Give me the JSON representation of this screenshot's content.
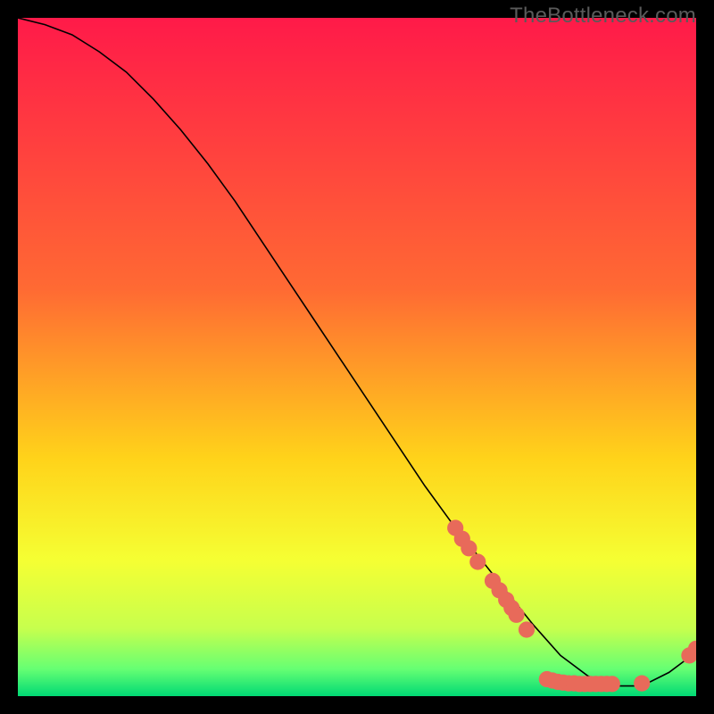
{
  "watermark": "TheBottleneck.com",
  "chart_data": {
    "type": "line",
    "title": "",
    "xlabel": "",
    "ylabel": "",
    "xlim": [
      0,
      100
    ],
    "ylim": [
      0,
      100
    ],
    "grid": false,
    "legend": false,
    "gradient_stops": [
      {
        "offset": 0.0,
        "color": "#ff1a49"
      },
      {
        "offset": 0.4,
        "color": "#ff6a33"
      },
      {
        "offset": 0.65,
        "color": "#ffd31a"
      },
      {
        "offset": 0.8,
        "color": "#f5ff33"
      },
      {
        "offset": 0.9,
        "color": "#c7ff4d"
      },
      {
        "offset": 0.96,
        "color": "#66ff73"
      },
      {
        "offset": 1.0,
        "color": "#00d974"
      }
    ],
    "series": [
      {
        "name": "bottleneck-curve",
        "x": [
          0,
          4,
          8,
          12,
          16,
          20,
          24,
          28,
          32,
          36,
          40,
          44,
          48,
          52,
          56,
          60,
          64,
          68,
          72,
          76,
          80,
          84,
          88,
          92,
          96,
          100
        ],
        "y": [
          100,
          99,
          97.5,
          95,
          92,
          88,
          83.5,
          78.5,
          73,
          67,
          61,
          55,
          49,
          43,
          37,
          31,
          25.5,
          20.5,
          15.5,
          10.5,
          6,
          3,
          1.5,
          1.5,
          3.5,
          6.5
        ]
      }
    ],
    "dot_cluster": {
      "name": "highlight-dots",
      "color": "#e86a5a",
      "radius_units": 1.2,
      "points": [
        {
          "x": 64.5,
          "y": 24.8
        },
        {
          "x": 65.5,
          "y": 23.2
        },
        {
          "x": 66.5,
          "y": 21.8
        },
        {
          "x": 67.8,
          "y": 19.8
        },
        {
          "x": 70.0,
          "y": 17.0
        },
        {
          "x": 71.0,
          "y": 15.6
        },
        {
          "x": 72.0,
          "y": 14.2
        },
        {
          "x": 72.8,
          "y": 13.0
        },
        {
          "x": 73.5,
          "y": 12.0
        },
        {
          "x": 75.0,
          "y": 9.8
        },
        {
          "x": 78.0,
          "y": 2.5
        },
        {
          "x": 78.8,
          "y": 2.3
        },
        {
          "x": 79.6,
          "y": 2.1
        },
        {
          "x": 80.4,
          "y": 2.0
        },
        {
          "x": 81.2,
          "y": 1.9
        },
        {
          "x": 82.0,
          "y": 1.9
        },
        {
          "x": 82.8,
          "y": 1.8
        },
        {
          "x": 83.6,
          "y": 1.8
        },
        {
          "x": 84.4,
          "y": 1.8
        },
        {
          "x": 85.2,
          "y": 1.8
        },
        {
          "x": 86.0,
          "y": 1.8
        },
        {
          "x": 86.8,
          "y": 1.8
        },
        {
          "x": 87.6,
          "y": 1.8
        },
        {
          "x": 92.0,
          "y": 1.9
        },
        {
          "x": 99.0,
          "y": 6.0
        },
        {
          "x": 100.0,
          "y": 7.0
        }
      ]
    }
  }
}
